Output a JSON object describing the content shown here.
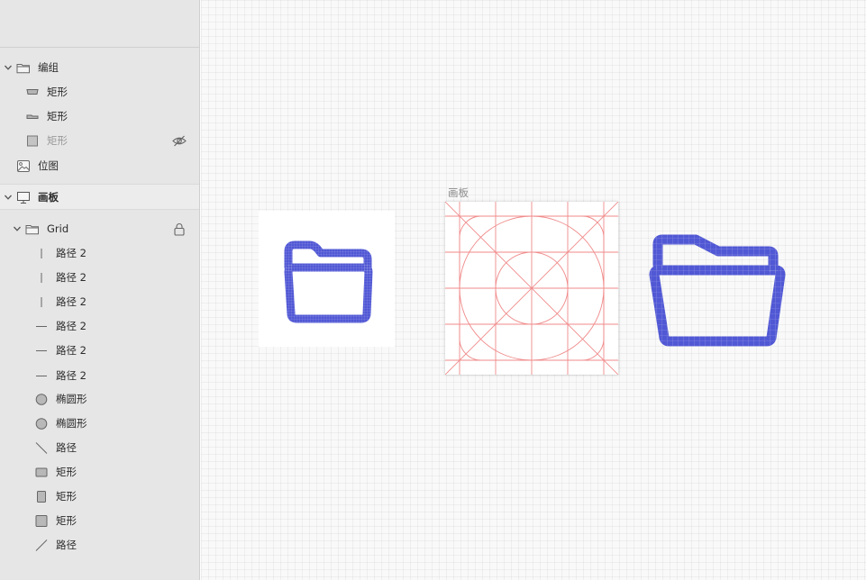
{
  "layers": {
    "group_name": "编组",
    "group_children": [
      "矩形",
      "矩形",
      "矩形"
    ],
    "bitmap_name": "位图",
    "artboard_name": "画板",
    "grid_name": "Grid",
    "grid_children": [
      "路径 2",
      "路径 2",
      "路径 2",
      "路径 2",
      "路径 2",
      "路径 2",
      "椭圆形",
      "椭圆形",
      "路径",
      "矩形",
      "矩形",
      "矩形",
      "路径"
    ]
  },
  "canvas": {
    "artboard_label": "画板"
  },
  "colors": {
    "icon_blue": "#5158d4",
    "grid_red": "#f08a8a",
    "sidebar_bg": "#e6e6e6"
  },
  "icons": {
    "group": "folder-icon",
    "rect": "rectangle-icon",
    "hidden": "eye-slash-icon",
    "bitmap": "image-icon",
    "artboard": "monitor-icon",
    "lock": "lock-icon",
    "ellipse": "circle-icon"
  }
}
